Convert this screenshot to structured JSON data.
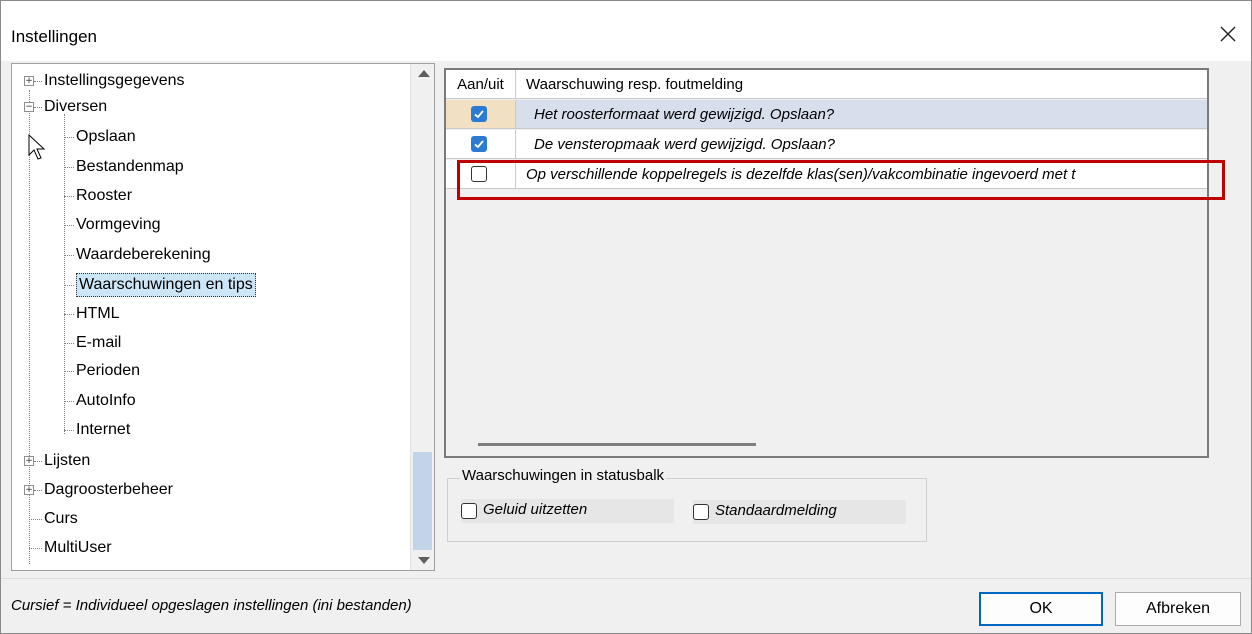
{
  "window": {
    "title": "Instellingen"
  },
  "tree": {
    "items": [
      {
        "label": "Instellingsgegevens",
        "expander": "+"
      },
      {
        "label": "Diversen",
        "expander": "−"
      },
      {
        "label": "Opslaan"
      },
      {
        "label": "Bestandenmap"
      },
      {
        "label": "Rooster"
      },
      {
        "label": "Vormgeving"
      },
      {
        "label": "Waardeberekening"
      },
      {
        "label": "Waarschuwingen en tips",
        "selected": true
      },
      {
        "label": "HTML"
      },
      {
        "label": "E-mail"
      },
      {
        "label": "Perioden"
      },
      {
        "label": "AutoInfo"
      },
      {
        "label": "Internet"
      },
      {
        "label": "Lijsten",
        "expander": "+"
      },
      {
        "label": "Dagroosterbeheer",
        "expander": "+"
      },
      {
        "label": "Curs"
      },
      {
        "label": "MultiUser"
      }
    ]
  },
  "grid": {
    "headers": [
      "Aan/uit",
      "Waarschuwing resp. foutmelding"
    ],
    "rows": [
      {
        "checked": true,
        "text": "Het roosterformaat werd gewijzigd. Opslaan?"
      },
      {
        "checked": true,
        "text": "De vensteropmaak werd gewijzigd. Opslaan?"
      },
      {
        "checked": false,
        "text": "Op verschillende koppelregels is dezelfde klas(sen)/vakcombinatie ingevoerd met t"
      }
    ]
  },
  "status_group": {
    "legend": "Waarschuwingen in statusbalk",
    "options": [
      {
        "label": "Geluid uitzetten",
        "checked": false
      },
      {
        "label": "Standaardmelding",
        "checked": false
      }
    ]
  },
  "footer": {
    "note": "Cursief = Individueel opgeslagen instellingen (ini bestanden)",
    "ok_label": "OK",
    "cancel_label": "Afbreken"
  },
  "colors": {
    "accent": "#0067c0",
    "checkbox_on": "#2a7bd1",
    "highlight": "#c00000",
    "selection": "#cde6f7"
  }
}
